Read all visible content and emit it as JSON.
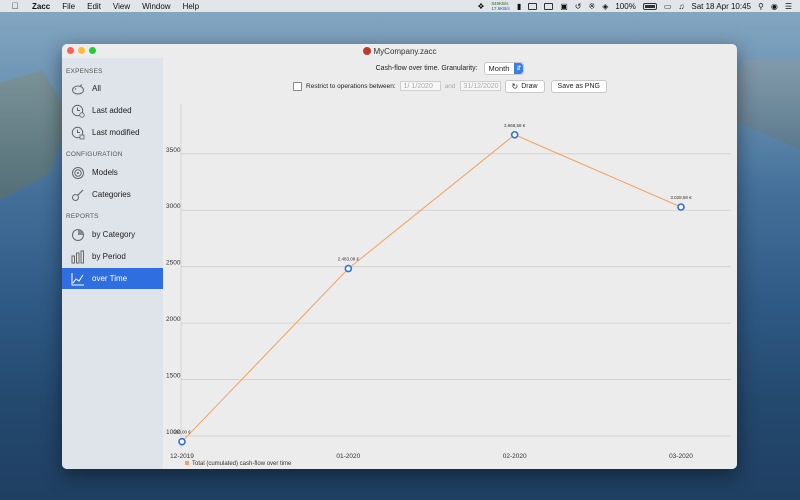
{
  "menubar": {
    "app_name": "Zacc",
    "menus": [
      "File",
      "Edit",
      "View",
      "Window",
      "Help"
    ],
    "net_up": "849KB/s",
    "net_down": "17.6KB/s",
    "battery": "100%",
    "clock": "Sat 18 Apr  10:45"
  },
  "window": {
    "title": "MyCompany.zacc"
  },
  "sidebar": {
    "sections": [
      {
        "title": "EXPENSES",
        "items": [
          {
            "label": "All",
            "icon": "piggy-bank-icon"
          },
          {
            "label": "Last added",
            "icon": "clock-plus-icon"
          },
          {
            "label": "Last modified",
            "icon": "clock-edit-icon"
          }
        ]
      },
      {
        "title": "CONFIGURATION",
        "items": [
          {
            "label": "Models",
            "icon": "target-icon"
          },
          {
            "label": "Categories",
            "icon": "guitar-icon"
          }
        ]
      },
      {
        "title": "REPORTS",
        "items": [
          {
            "label": "by Category",
            "icon": "pie-chart-icon"
          },
          {
            "label": "by Period",
            "icon": "bar-chart-icon"
          },
          {
            "label": "over Time",
            "icon": "line-chart-icon"
          }
        ]
      }
    ],
    "selected": "over Time"
  },
  "toolbar": {
    "title_label": "Cash-flow over time. Granularity:",
    "granularity": "Month",
    "restrict_label": "Restrict to operations between:",
    "date_from": "1/  1/2020",
    "and_label": "and",
    "date_to": "31/12/2020",
    "draw_label": "Draw",
    "save_label": "Save as PNG"
  },
  "chart_data": {
    "type": "line",
    "categories": [
      "12-2019",
      "01-2020",
      "02-2020",
      "03-2020"
    ],
    "series": [
      {
        "name": "Total (cumulated) cash-flow over time",
        "values": [
          950,
          2483.08,
          3668.58,
          3028.58
        ],
        "labels": [
          "950,00 €",
          "2.483,08 €",
          "3.668,58 €",
          "3.028,58 €"
        ]
      }
    ],
    "yticks": [
      1000,
      1500,
      2000,
      2500,
      3000,
      3500
    ],
    "ylim": [
      894,
      3941
    ],
    "line_color": "#f4a261",
    "marker_color": "#2f6ee0",
    "grid": true,
    "legend": "bottom-left"
  }
}
